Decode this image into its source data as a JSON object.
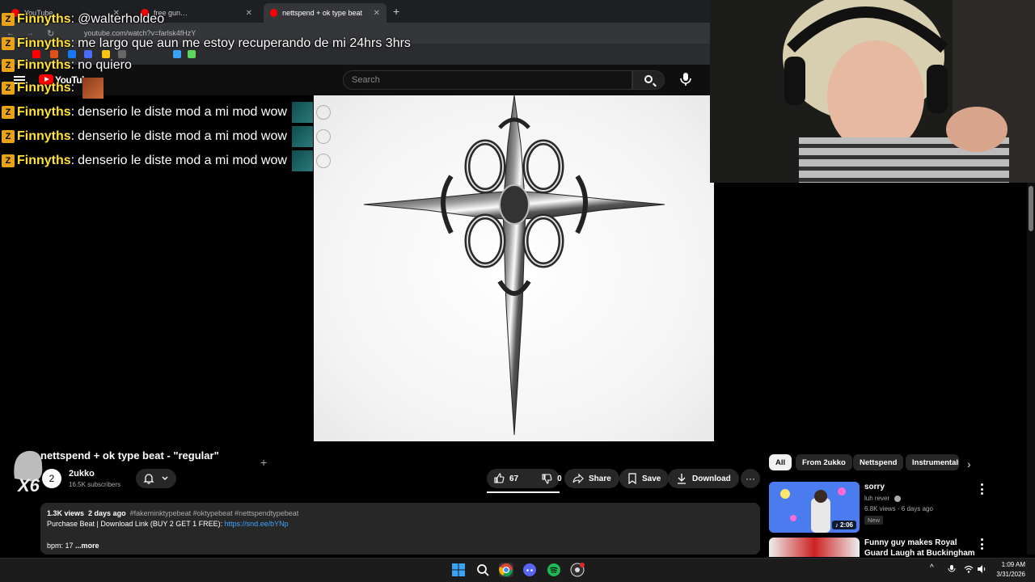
{
  "browser": {
    "tabs": [
      {
        "label": "YouTube"
      },
      {
        "label": "free gun…"
      },
      {
        "label": "nettspend + ok type beat - \"reg"
      }
    ],
    "url": "youtube.com/watch?v=farlsk4fHzY"
  },
  "youtube": {
    "logo_text": "YouTube",
    "search_placeholder": "Search"
  },
  "chat": [
    {
      "badge": "Z",
      "name": "Finnyths",
      "message": "@walterholdeo"
    },
    {
      "badge": "Z",
      "name": "Finnyths",
      "message": "me largo que aun me estoy recuperando de mi 24hrs 3hrs"
    },
    {
      "badge": "Z",
      "name": "Finnyths",
      "message": "no quiero"
    },
    {
      "badge": "Z",
      "name": "Finnyths",
      "message": ""
    },
    {
      "badge": "Z",
      "name": "Finnyths",
      "message": "denserio le diste mod a mi mod wow"
    },
    {
      "badge": "Z",
      "name": "Finnyths",
      "message": "denserio le diste mod a mi mod wow"
    },
    {
      "badge": "Z",
      "name": "Finnyths",
      "message": "denserio le diste mod a mi mod wow"
    }
  ],
  "video": {
    "title": "nettspend + ok type beat - \"regular\"",
    "channel": {
      "avatar": "2",
      "name": "2ukko",
      "subscribers": "16.5K subscribers"
    },
    "likes": "67",
    "dislikes": "0",
    "share_label": "Share",
    "save_label": "Save",
    "download_label": "Download",
    "more_label": "···",
    "overlay_text": "X6"
  },
  "description": {
    "views": "1.3K views",
    "age": "2 days ago",
    "tags": "#fakeminktypebeat #oktypebeat #nettspendtypebeat",
    "line2_prefix": "Purchase Beat | Download Link (BUY 2 GET 1 FREE):",
    "link": "https://snd.ee/bYNp",
    "line3": "bpm: 17",
    "more": "...more"
  },
  "sidebar": {
    "chips": [
      "All",
      "From 2ukko",
      "Nettspend",
      "Instrumentals"
    ],
    "recommendations": [
      {
        "title": "sorry",
        "channel": "luh rever",
        "meta": "6.8K views · 6 days ago",
        "badge": "New",
        "duration": "♪ 2:06"
      },
      {
        "title": "Funny guy makes Royal Guard Laugh at Buckingham Palace"
      }
    ]
  },
  "taskbar": {
    "time": "1:09 AM",
    "date": "3/31/2026"
  },
  "colors": {
    "yt_red": "#ff0000",
    "chat_name": "#ffe135",
    "link_blue": "#3ea6ff"
  }
}
